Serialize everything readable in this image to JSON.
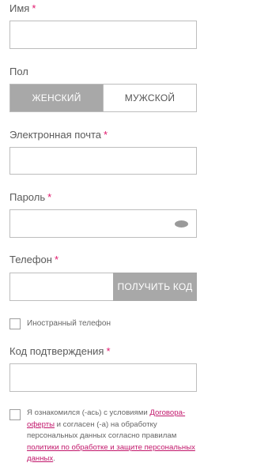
{
  "form": {
    "name": {
      "label": "Имя",
      "required_mark": "*",
      "value": ""
    },
    "gender": {
      "label": "Пол",
      "options": [
        "ЖЕНСКИЙ",
        "МУЖСКОЙ"
      ],
      "selected": "ЖЕНСКИЙ"
    },
    "email": {
      "label": "Электронная почта",
      "required_mark": "*",
      "value": ""
    },
    "password": {
      "label": "Пароль",
      "required_mark": "*",
      "value": ""
    },
    "phone": {
      "label": "Телефон",
      "required_mark": "*",
      "value": "",
      "get_code_button": "ПОЛУЧИТЬ КОД"
    },
    "foreign_phone": {
      "label": "Иностранный телефон",
      "checked": false
    },
    "confirm_code": {
      "label": "Код подтверждения",
      "required_mark": "*",
      "value": ""
    },
    "consent": {
      "checked": false,
      "text_1": "Я ознакомился (-ась) с условиями ",
      "link_1": "Договора-оферты",
      "text_2": " и согласен (-а) на обработку персональных данных согласно правилам ",
      "link_2": "политики по обработке и защите персональных данных",
      "text_3": "."
    }
  },
  "colors": {
    "accent": "#e0186c",
    "link": "#c2186c",
    "button_gray": "#a8a8a8",
    "border": "#bdbdbd"
  }
}
